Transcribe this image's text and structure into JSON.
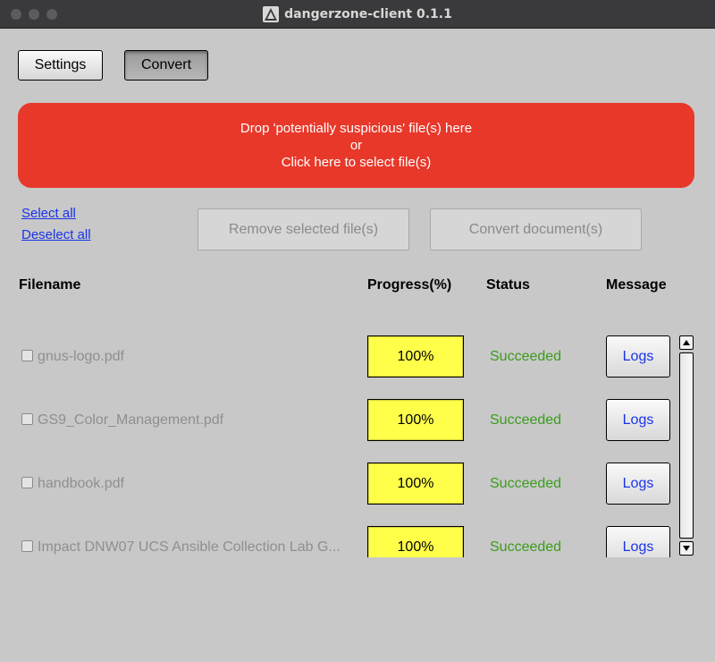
{
  "window": {
    "title": "dangerzone-client 0.1.1"
  },
  "toolbar": {
    "settings_label": "Settings",
    "convert_label": "Convert"
  },
  "dropzone": {
    "line1": "Drop 'potentially suspicious' file(s) here",
    "line2": "or",
    "line3": "Click here to select file(s)"
  },
  "selection": {
    "select_all": "Select all",
    "deselect_all": "Deselect all"
  },
  "actions": {
    "remove_label": "Remove selected file(s)",
    "convert_docs_label": "Convert document(s)"
  },
  "table": {
    "headers": {
      "filename": "Filename",
      "progress": "Progress(%)",
      "status": "Status",
      "message": "Message"
    },
    "rows": [
      {
        "filename": "gnus-logo.pdf",
        "progress": "100%",
        "status": "Succeeded",
        "message": "Logs"
      },
      {
        "filename": "GS9_Color_Management.pdf",
        "progress": "100%",
        "status": "Succeeded",
        "message": "Logs"
      },
      {
        "filename": "handbook.pdf",
        "progress": "100%",
        "status": "Succeeded",
        "message": "Logs"
      },
      {
        "filename": "Impact DNW07 UCS Ansible Collection Lab G...",
        "progress": "100%",
        "status": "Succeeded",
        "message": "Logs"
      }
    ]
  },
  "colors": {
    "dropzone": "#e8382a",
    "progress_fill": "#ffff4a",
    "status_success": "#3b9c1c",
    "link": "#1a33e8"
  }
}
